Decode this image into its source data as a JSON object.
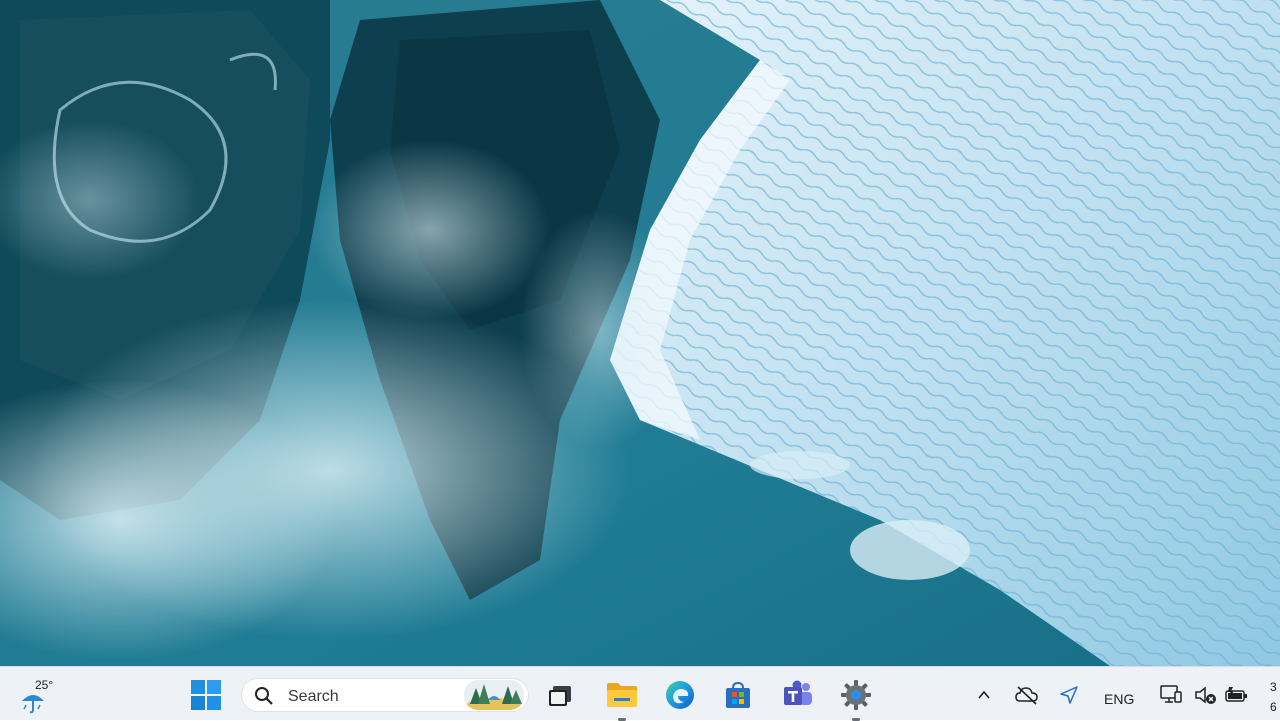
{
  "taskbar": {
    "weather": {
      "temperature": "25°",
      "icon": "rain-umbrella-icon"
    },
    "start": {
      "icon": "windows-start-icon",
      "accent_color": "#1f8fe0"
    },
    "search": {
      "label": "Search",
      "icon": "search-icon",
      "highlight_icon": "search-highlight-landscape-icon"
    },
    "apps": [
      {
        "name": "Task View",
        "icon": "task-view-icon"
      },
      {
        "name": "File Explorer",
        "icon": "file-explorer-folder-icon",
        "running": true
      },
      {
        "name": "Microsoft Edge",
        "icon": "edge-browser-icon"
      },
      {
        "name": "Microsoft Store",
        "icon": "store-bag-icon"
      },
      {
        "name": "Microsoft Teams",
        "icon": "teams-icon"
      },
      {
        "name": "Settings",
        "icon": "settings-gear-icon",
        "running": true
      }
    ],
    "tray": {
      "chevron_icon": "chevron-up-icon",
      "onedrive_icon": "onedrive-offline-icon",
      "location_icon": "location-arrow-icon",
      "language": "ENG",
      "network_icon": "network-monitor-icon",
      "volume_icon": "volume-muted-icon",
      "battery_icon": "battery-icon"
    },
    "clock": {
      "line1": "3",
      "line2": "6"
    }
  },
  "desktop": {
    "wallpaper": "glacier-aerial-wallpaper"
  }
}
